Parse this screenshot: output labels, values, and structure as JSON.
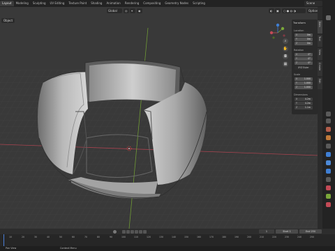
{
  "menu": {
    "tabs": [
      "Layout",
      "Modeling",
      "Sculpting",
      "UV Editing",
      "Texture Paint",
      "Shading",
      "Animation",
      "Rendering",
      "Compositing",
      "Geometry Nodes",
      "Scripting"
    ],
    "scene": "Scene"
  },
  "header": {
    "orientation": "Global",
    "options": "Options",
    "mode": "Object"
  },
  "npanel": {
    "title": "Transform",
    "location_label": "Location",
    "location": [
      {
        "ax": "X",
        "v": "0m"
      },
      {
        "ax": "Y",
        "v": "0m"
      },
      {
        "ax": "Z",
        "v": "0m"
      }
    ],
    "rotation_label": "Rotation",
    "rotation": [
      {
        "ax": "X",
        "v": "0°"
      },
      {
        "ax": "Y",
        "v": "0°"
      },
      {
        "ax": "Z",
        "v": "0°"
      }
    ],
    "rotation_mode": "XYZ Euler",
    "scale_label": "Scale",
    "scale": [
      {
        "ax": "X",
        "v": "1.000"
      },
      {
        "ax": "Y",
        "v": "1.000"
      },
      {
        "ax": "Z",
        "v": "1.000"
      }
    ],
    "dimensions_label": "Dimensions",
    "dimensions": [
      {
        "ax": "X",
        "v": "4.2m"
      },
      {
        "ax": "Y",
        "v": "4.2m"
      },
      {
        "ax": "Z",
        "v": "1.1m"
      }
    ]
  },
  "vertical_tabs": [
    "Item",
    "Tool",
    "View",
    "Create",
    "Edit"
  ],
  "timeline": {
    "frames": [
      "10",
      "20",
      "30",
      "40",
      "50",
      "60",
      "70",
      "80",
      "90",
      "100",
      "110",
      "120",
      "130",
      "140",
      "150",
      "160",
      "170",
      "180",
      "190",
      "200",
      "210",
      "220",
      "230",
      "240",
      "250"
    ],
    "current_frame": "1",
    "start_label": "Start",
    "start": "1",
    "end_label": "End",
    "end": "250"
  },
  "status": {
    "left": "Pan View",
    "right": "Context Menu"
  },
  "colors": {
    "accent_orange": "#e8933a",
    "axis_x": "#c34a56",
    "axis_y": "#7ba73a",
    "axis_z": "#3f7fd4"
  }
}
